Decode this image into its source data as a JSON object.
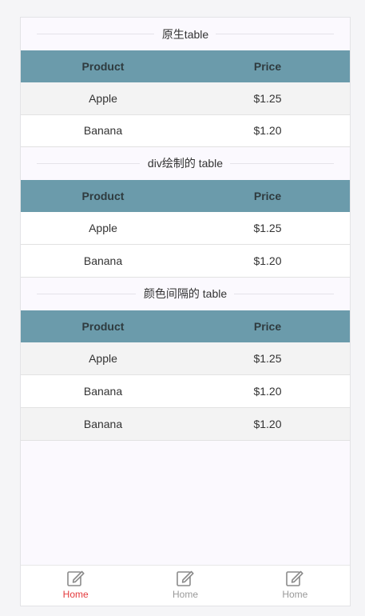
{
  "section1": {
    "title": "原生table",
    "header": [
      "Product",
      "Price"
    ],
    "rows": [
      [
        "Apple",
        "$1.25"
      ],
      [
        "Banana",
        "$1.20"
      ]
    ]
  },
  "section2": {
    "title": "div绘制的 table",
    "header": [
      "Product",
      "Price"
    ],
    "rows": [
      [
        "Apple",
        "$1.25"
      ],
      [
        "Banana",
        "$1.20"
      ]
    ]
  },
  "section3": {
    "title": "颜色间隔的 table",
    "header": [
      "Product",
      "Price"
    ],
    "rows": [
      [
        "Apple",
        "$1.25"
      ],
      [
        "Banana",
        "$1.20"
      ],
      [
        "Banana",
        "$1.20"
      ]
    ]
  },
  "tabbar": {
    "items": [
      {
        "label": "Home",
        "icon": "edit-icon",
        "active": true
      },
      {
        "label": "Home",
        "icon": "edit-icon",
        "active": false
      },
      {
        "label": "Home",
        "icon": "edit-icon",
        "active": false
      }
    ]
  },
  "colors": {
    "header_bg": "#6b9bab",
    "active_tab": "#e4393c",
    "inactive_tab": "#999999"
  }
}
